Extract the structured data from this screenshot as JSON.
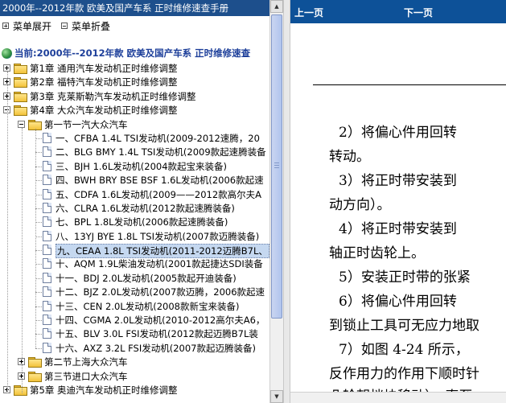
{
  "left_panel": {
    "title": "2000年--2012年款 欧美及国产车系 正时维修速查手册",
    "expand_all": "菜单展开",
    "collapse_all": "菜单折叠",
    "current": "当前:2000年--2012年款 欧美及国产车系 正时维修速查",
    "tree": [
      {
        "label": "第1章 通用汽车发动机正时维修调整",
        "level": 0,
        "expanded": false
      },
      {
        "label": "第2章 福特汽车发动机正时维修调整",
        "level": 0,
        "expanded": false
      },
      {
        "label": "第3章 克莱斯勒汽车发动机正时维修调整",
        "level": 0,
        "expanded": false
      },
      {
        "label": "第4章 大众汽车发动机正时维修调整",
        "level": 0,
        "expanded": true
      },
      {
        "label": "第一节一汽大众汽车",
        "level": 1,
        "expanded": true
      },
      {
        "label": "一、CFBA 1.4L TSI发动机(2009-2012速腾，20",
        "level": 2
      },
      {
        "label": "二、BLG BMY 1.4L TSI发动机(2009款起速腾装备",
        "level": 2
      },
      {
        "label": "三、BJH 1.6L发动机(2004款起宝来装备)",
        "level": 2
      },
      {
        "label": "四、BWH BRY BSE BSF 1.6L发动机(2006款起速",
        "level": 2
      },
      {
        "label": "五、CDFA 1.6L发动机(2009——2012款高尔夫A",
        "level": 2
      },
      {
        "label": "六、CLRA 1.6L发动机(2012款起速腾装备)",
        "level": 2
      },
      {
        "label": "七、BPL 1.8L发动机(2006款起速腾装备)",
        "level": 2
      },
      {
        "label": "八、13YJ BYE 1.8L TSI发动机(2007款迈腾装备)",
        "level": 2
      },
      {
        "label": "九、CEAA 1.8L TSI发动机(2011-2012迈腾B7L、",
        "level": 2,
        "selected": true
      },
      {
        "label": "十、AQM 1.9L柴油发动机(2001款起捷达SDI装备",
        "level": 2
      },
      {
        "label": "十一、BDJ 2.0L发动机(2005款起开迪装备)",
        "level": 2
      },
      {
        "label": "十二、BJZ 2.0L发动机(2007款迈腾，2006款起速",
        "level": 2
      },
      {
        "label": "十三、CEN 2.0L发动机(2008款新宝来装备)",
        "level": 2
      },
      {
        "label": "十四、CGMA 2.0L发动机(2010-2012高尔夫A6，",
        "level": 2
      },
      {
        "label": "十五、BLV 3.0L FSI发动机(2012款起迈腾B7L装",
        "level": 2
      },
      {
        "label": "十六、AXZ 3.2L FSI发动机(2007款起迈腾装备)",
        "level": 2
      },
      {
        "label": "第二节上海大众汽车",
        "level": 1,
        "expanded": false
      },
      {
        "label": "第三节进口大众汽车",
        "level": 1,
        "expanded": false
      },
      {
        "label": "第5章 奥迪汽车发动机正时维修调整",
        "level": 0,
        "expanded": false
      }
    ]
  },
  "right_panel": {
    "prev_label": "上一页",
    "next_label": "下一页",
    "paragraphs": [
      "2）将偏心件用回转",
      "转动。",
      "3）将正时带安装到",
      "动方向）。",
      "4）将正时带安装到",
      "轴正时齿轮上。",
      "5）安装正时带的张紧",
      "6）将偏心件用回转",
      "到锁止工具可无应力地取",
      "7）如图 4-24 所示，",
      "反作用力的作用下顺时针",
      "凸轮朝挡块移动），直至"
    ]
  },
  "colors": {
    "title_bar": "#1d4f8c",
    "nav_bar": "#0d5198",
    "current_text": "#1d3f9a",
    "selected_bg": "#c5d8f0"
  }
}
